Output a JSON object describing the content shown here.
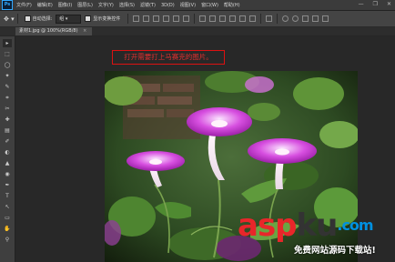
{
  "app": {
    "logo": "Ps"
  },
  "menubar": {
    "items": [
      "文件(F)",
      "编辑(E)",
      "图像(I)",
      "图层(L)",
      "文字(Y)",
      "选择(S)",
      "滤镜(T)",
      "3D(D)",
      "视图(V)",
      "窗口(W)",
      "帮助(H)"
    ]
  },
  "window_controls": {
    "minimize": "—",
    "restore": "❐",
    "close": "✕"
  },
  "options": {
    "auto_select_label": "自动选择:",
    "auto_select_value": "组",
    "transform_label": "显示变换控件"
  },
  "document": {
    "tab_title": "素材1.jpg @ 100%(RGB/8)",
    "close_glyph": "×"
  },
  "annotation": {
    "text": "打开需要打上马赛克的图片。"
  },
  "watermark": {
    "logo_red": "asp",
    "logo_dark": "ku",
    "logo_suffix": ".com",
    "subtitle": "免费网站源码下载站!"
  },
  "tools": [
    "▸",
    "⬚",
    "◯",
    "✦",
    "✎",
    "⌗",
    "✂",
    "✚",
    "▤",
    "✐",
    "◐",
    "▲",
    "◉",
    "✒",
    "T",
    "↖",
    "▭",
    "✋",
    "⚲"
  ]
}
